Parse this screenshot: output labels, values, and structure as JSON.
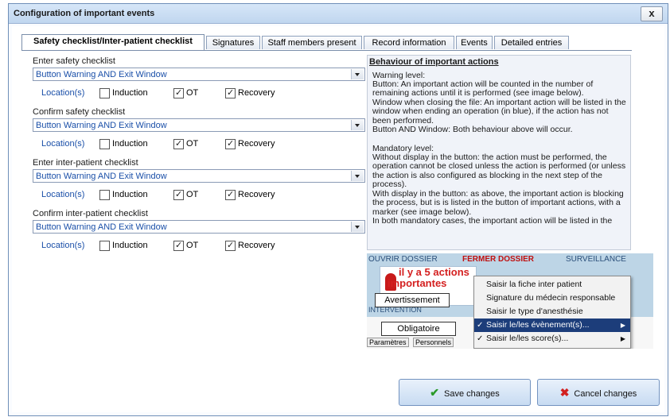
{
  "window": {
    "title": "Configuration of important events",
    "close_label": "x"
  },
  "tabs": [
    {
      "label": "Safety checklist/Inter-patient checklist",
      "active": true
    },
    {
      "label": "Signatures",
      "active": false
    },
    {
      "label": "Staff members present",
      "active": false
    },
    {
      "label": "Record information",
      "active": false
    },
    {
      "label": "Events",
      "active": false
    },
    {
      "label": "Detailed entries",
      "active": false
    }
  ],
  "checklists": [
    {
      "label": "Enter safety checklist",
      "value": "Button Warning AND Exit Window",
      "locations_label": "Location(s)",
      "options": [
        {
          "label": "Induction",
          "checked": false
        },
        {
          "label": "OT",
          "checked": true
        },
        {
          "label": "Recovery",
          "checked": true
        }
      ]
    },
    {
      "label": "Confirm safety checklist",
      "value": "Button Warning AND Exit Window",
      "locations_label": "Location(s)",
      "options": [
        {
          "label": "Induction",
          "checked": false
        },
        {
          "label": "OT",
          "checked": true
        },
        {
          "label": "Recovery",
          "checked": true
        }
      ]
    },
    {
      "label": "Enter inter-patient checklist",
      "value": "Button Warning AND Exit Window",
      "locations_label": "Location(s)",
      "options": [
        {
          "label": "Induction",
          "checked": false
        },
        {
          "label": "OT",
          "checked": true
        },
        {
          "label": "Recovery",
          "checked": true
        }
      ]
    },
    {
      "label": "Confirm inter-patient checklist",
      "value": "Button Warning AND Exit Window",
      "locations_label": "Location(s)",
      "options": [
        {
          "label": "Induction",
          "checked": false
        },
        {
          "label": "OT",
          "checked": true
        },
        {
          "label": "Recovery",
          "checked": true
        }
      ]
    }
  ],
  "info": {
    "heading": "Behaviour of important actions",
    "paragraphs": [
      "Warning level:",
      "Button: An important action will be counted in the number of remaining actions until it is performed (see image below).",
      "Window when closing the file: An important action will be listed in the window when ending an operation (in blue), if the action has not been performed.",
      "Button AND Window: Both behaviour above will occur.",
      "Mandatory level:",
      "Without display in the button: the action must be performed, the operation cannot be closed unless the action is performed (or unless the action is also configured as blocking in the next step of the process).",
      "With display in the button: as above, the important action is blocking the process, but is is listed in the button of important actions, with a marker (see image below).",
      "In both mandatory cases, the important action will be listed in the"
    ]
  },
  "illustration": {
    "header_left": "OUVRIR DOSSIER",
    "header_mid": "FERMER DOSSIER",
    "header_right": "SURVEILLANCE",
    "alert_line1": "il y a 5 actions",
    "alert_line2": "importantes",
    "left_label": "INTERVENTION",
    "callout_warning": "Avertissement",
    "callout_mandatory": "Obligatoire",
    "bottom_tabs": [
      "Paramètres",
      "Personnels"
    ],
    "menu_items": [
      {
        "label": "Saisir la fiche inter patient",
        "checked": false,
        "submenu": false,
        "selected": false
      },
      {
        "label": "Signature du médecin responsable",
        "checked": false,
        "submenu": false,
        "selected": false
      },
      {
        "label": "Saisir le type d'anesthésie",
        "checked": false,
        "submenu": false,
        "selected": false
      },
      {
        "label": "Saisir le/les évènement(s)...",
        "checked": true,
        "submenu": true,
        "selected": true
      },
      {
        "label": "Saisir le/les score(s)...",
        "checked": true,
        "submenu": true,
        "selected": false
      }
    ]
  },
  "buttons": {
    "save_label": "Save changes",
    "cancel_label": "Cancel changes"
  },
  "colors": {
    "accent_blue": "#1a4fa8",
    "alert_red": "#d42020",
    "menu_selected": "#1c3d7a"
  }
}
